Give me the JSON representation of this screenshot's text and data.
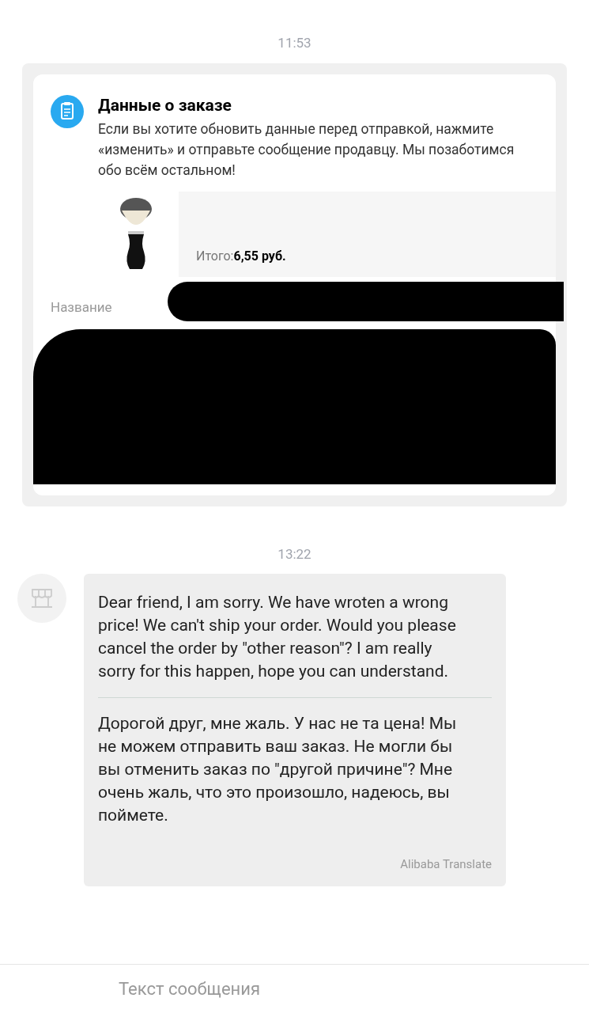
{
  "messages": [
    {
      "kind": "order_card",
      "time": "11:53",
      "title": "Данные о заказе",
      "description": "Если вы хотите обновить данные перед отправкой, нажмите «изменить» и отправьте сообщение продавцу. Мы позаботимся обо всём остальном!",
      "product": {
        "total_label": "Итого:",
        "total_value": "6,55 руб."
      },
      "fields": [
        {
          "label": "Название"
        }
      ]
    },
    {
      "kind": "text",
      "time": "13:22",
      "original": "Dear friend, I am sorry. We have wroten a wrong price! We can't ship your order. Would you please cancel the order by \"other reason\"? I am really sorry for this happen, hope you can understand.",
      "translation": "Дорогой друг, мне жаль. У нас не та цена! Мы не можем отправить ваш заказ. Не могли бы вы отменить заказ по \"другой причине\"? Мне очень жаль, что это произошло, надеюсь, вы поймете.",
      "translator": "Alibaba Translate"
    }
  ],
  "composer": {
    "placeholder": "Текст сообщения"
  }
}
